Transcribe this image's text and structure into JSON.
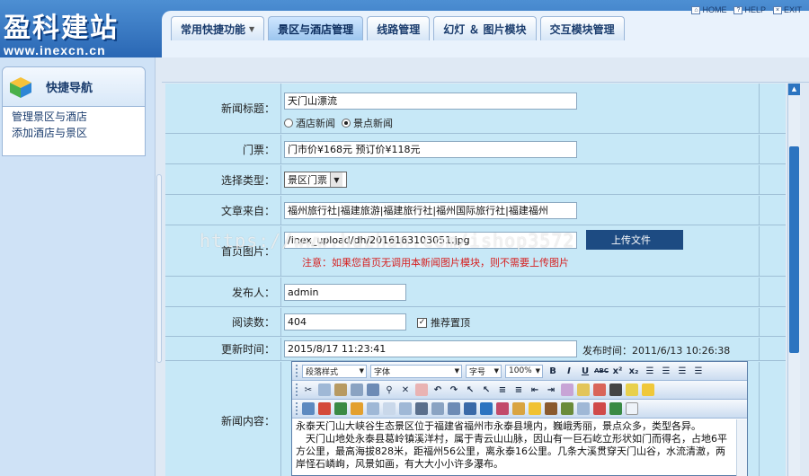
{
  "header": {
    "logo_title": "盈科建站",
    "logo_url": "www.inexcn.cn",
    "tabs": [
      {
        "label": "常用快捷功能"
      },
      {
        "label": "景区与酒店管理"
      },
      {
        "label": "线路管理"
      },
      {
        "label": "幻灯 ＆ 图片模块"
      },
      {
        "label": "交互模块管理"
      }
    ],
    "toplinks": {
      "home": "HOME",
      "help": "HELP",
      "exit": "EXIT"
    }
  },
  "sidebar": {
    "title": "快捷导航",
    "items": [
      {
        "label": "管理景区与酒店"
      },
      {
        "label": "添加酒店与景区"
      }
    ]
  },
  "form": {
    "title": {
      "label": "新闻标题：",
      "value": "天门山漂流"
    },
    "news_type": {
      "options": [
        "酒店新闻",
        "景点新闻"
      ],
      "selected": "景点新闻"
    },
    "ticket": {
      "label": "门票：",
      "value": "门市价¥168元 预订价¥118元"
    },
    "category": {
      "label": "选择类型：",
      "value": "景区门票"
    },
    "source": {
      "label": "文章来自：",
      "value": "福州旅行社|福建旅游|福建旅行社|福州国际旅行社|福建福州"
    },
    "image": {
      "label": "首页图片：",
      "value": "/inex_upload/dh/2016163103051.jpg",
      "upload_label": "上传文件",
      "note": "注意：如果您首页无调用本新闻图片模块，则不需要上传图片"
    },
    "publisher": {
      "label": "发布人：",
      "value": "admin"
    },
    "views": {
      "label": "阅读数：",
      "value": "404",
      "top_label": "推荐置顶"
    },
    "update_time": {
      "label": "更新时间：",
      "value": "2015/8/17 11:23:41",
      "publish_time": "发布时间：2011/6/13 10:26:38"
    },
    "content": {
      "label": "新闻内容：",
      "toolbar": {
        "paragraph": "段落样式",
        "font": "字体",
        "size": "字号",
        "zoom": "100%"
      },
      "body": "永泰天门山大峡谷生态景区位于福建省福州市永泰县境内，巍峨秀丽，景点众多，类型各异。\n　天门山地处永泰县葛岭镇溪洋村，属于青云山山脉，因山有一巨石屹立形状如门而得名，占地6平方公里，最高海拔828米，距福州56公里，离永泰16公里。几条大溪贯穿天门山谷，水流清澈，两岸怪石嶙峋，风景如画，有大大小小许多瀑布。"
    }
  },
  "watermark": "https://www.huzhan.com/ishop3572",
  "colors": {
    "header": "#2a67b4",
    "form_bg": "#c7e8f7",
    "upload_button": "#1d4b82",
    "note": "#d62020"
  }
}
